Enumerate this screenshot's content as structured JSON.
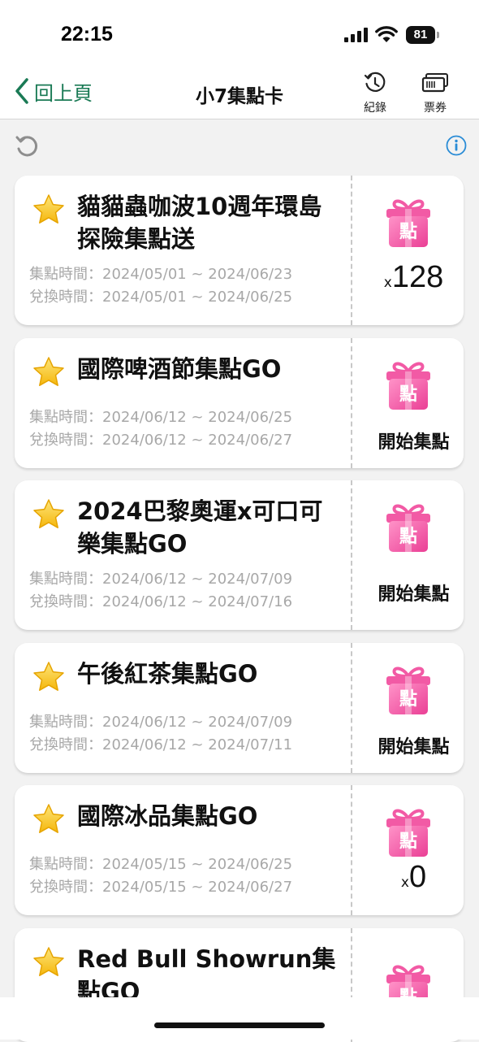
{
  "status_bar": {
    "time": "22:15",
    "battery": "81"
  },
  "nav": {
    "back_label": "回上頁",
    "title": "小7集點卡",
    "history_label": "紀錄",
    "tickets_label": "票券"
  },
  "colors": {
    "accent": "#1a7a55",
    "gift": "#f25aa5",
    "info": "#2a8cd6",
    "star": "#f7c416"
  },
  "gift_icon_text": "點",
  "cards": [
    {
      "title": "貓貓蟲咖波10週年環島探險集點送",
      "collect": "集點時間：2024/05/01 ~ 2024/06/23",
      "redeem": "兌換時間：2024/05/01 ~ 2024/06/25",
      "count_prefix": "x",
      "count": "128"
    },
    {
      "title": "國際啤酒節集點GO",
      "collect": "集點時間：2024/06/12 ~ 2024/06/25",
      "redeem": "兌換時間：2024/06/12 ~ 2024/06/27",
      "action": "開始集點"
    },
    {
      "title": "2024巴黎奧運x可口可樂集點GO",
      "collect": "集點時間：2024/06/12 ~ 2024/07/09",
      "redeem": "兌換時間：2024/06/12 ~ 2024/07/16",
      "action": "開始集點"
    },
    {
      "title": "午後紅茶集點GO",
      "collect": "集點時間：2024/06/12 ~ 2024/07/09",
      "redeem": "兌換時間：2024/06/12 ~ 2024/07/11",
      "action": "開始集點"
    },
    {
      "title": "國際冰品集點GO",
      "collect": "集點時間：2024/05/15 ~ 2024/06/25",
      "redeem": "兌換時間：2024/05/15 ~ 2024/06/27",
      "count_prefix": "x",
      "count": "0"
    },
    {
      "title": "Red Bull Showrun集點GO"
    }
  ]
}
